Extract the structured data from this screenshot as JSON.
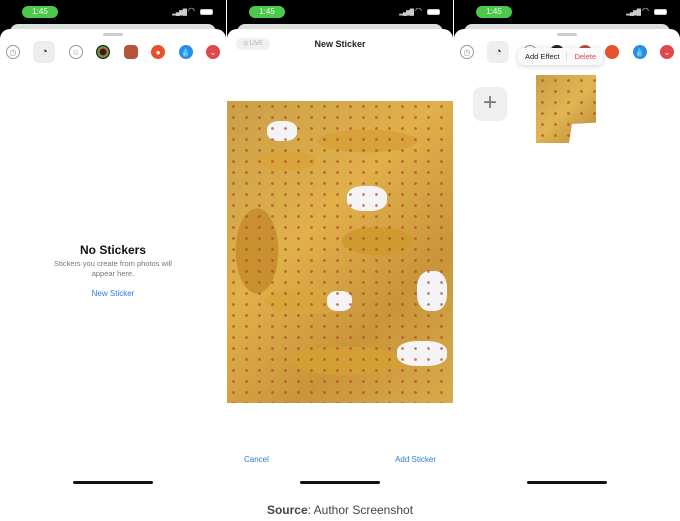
{
  "status": {
    "time": "1:45"
  },
  "apps": [
    "clock-icon",
    "sticker-icon",
    "emoji-icon",
    "activity-icon",
    "memoji-icon",
    "reddit-icon",
    "water-icon",
    "pocket-icon"
  ],
  "colors": {
    "accent": "#2f7ce0",
    "delete": "#e0474c",
    "time_pill": "#4cc94a"
  },
  "screen1": {
    "title": "No Stickers",
    "subtitle": "Stickers you create from photos will appear here.",
    "link": "New Sticker"
  },
  "screen2": {
    "live": "◎ LIVE",
    "title": "New Sticker",
    "cancel": "Cancel",
    "add": "Add Sticker"
  },
  "screen3": {
    "add_effect": "Add Effect",
    "delete": "Delete",
    "plus": "+"
  },
  "caption": {
    "bold": "Source",
    "rest": ": Author Screenshot"
  }
}
